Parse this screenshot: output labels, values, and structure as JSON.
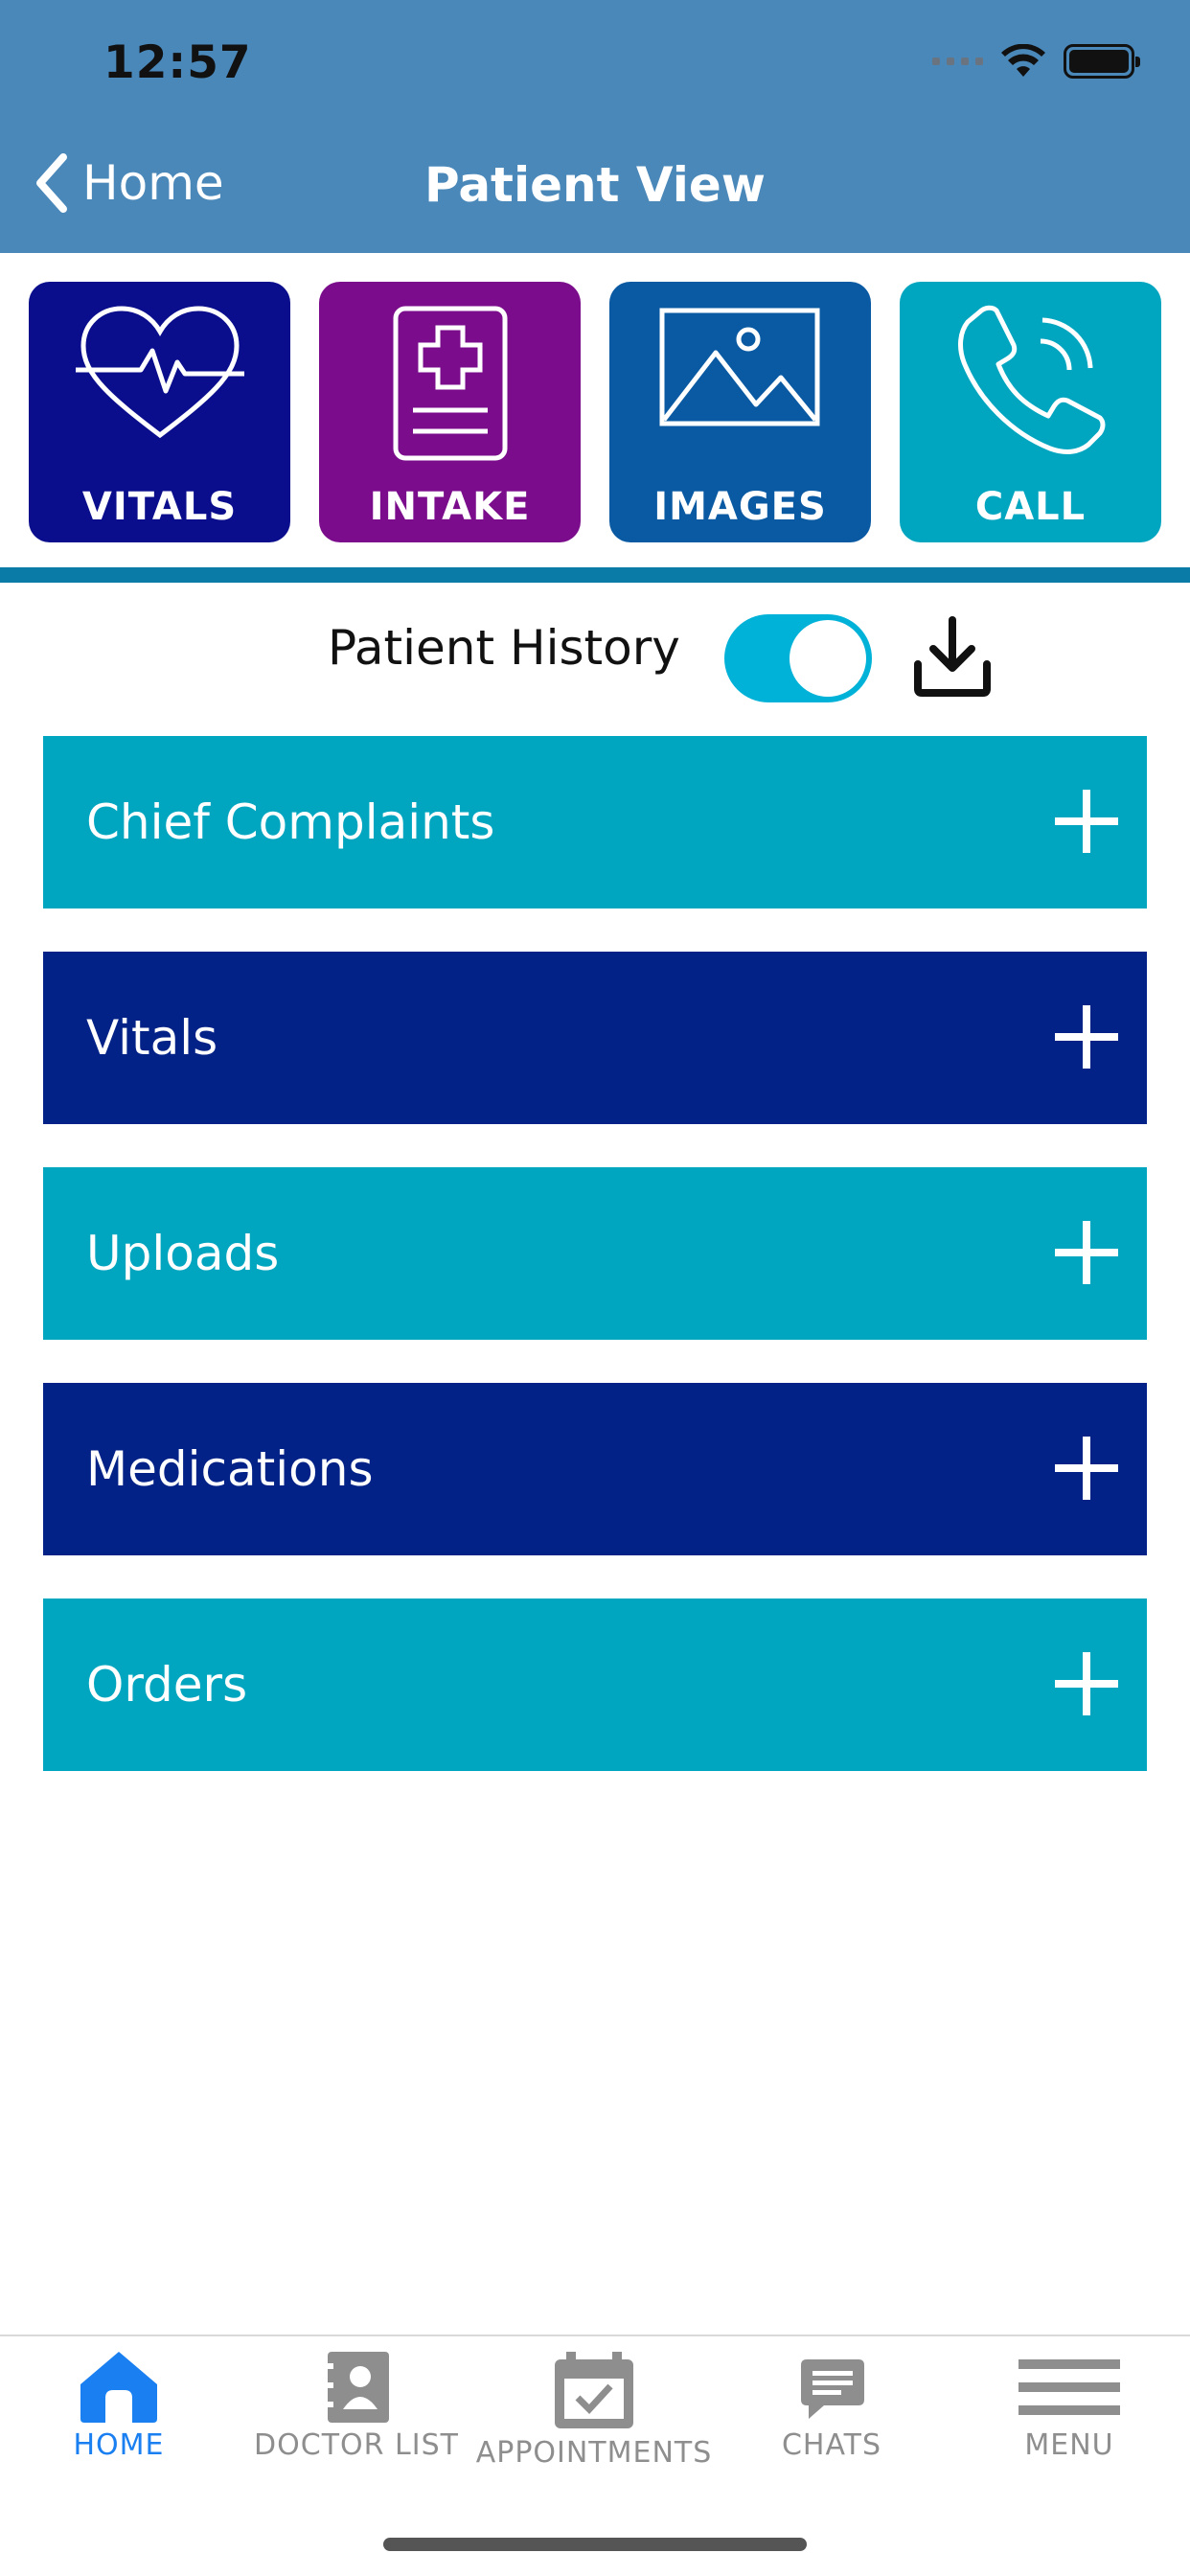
{
  "status_bar": {
    "time": "12:57"
  },
  "nav": {
    "back_label": "Home",
    "title": "Patient View"
  },
  "tiles": [
    {
      "label": "VITALS",
      "icon": "heart-pulse-icon",
      "color": "#0b0e8c"
    },
    {
      "label": "INTAKE",
      "icon": "medical-form-icon",
      "color": "#7b0d8c"
    },
    {
      "label": "IMAGES",
      "icon": "image-icon",
      "color": "#0a5aa3"
    },
    {
      "label": "CALL",
      "icon": "phone-icon",
      "color": "#00a6c0"
    }
  ],
  "history": {
    "label": "Patient History",
    "toggle_on": true
  },
  "sections": [
    {
      "label": "Chief Complaints",
      "color": "#00a6c0"
    },
    {
      "label": "Vitals",
      "color": "#022287"
    },
    {
      "label": "Uploads",
      "color": "#00a6c0"
    },
    {
      "label": "Medications",
      "color": "#022287"
    },
    {
      "label": "Orders",
      "color": "#00a6c0"
    }
  ],
  "tabbar": {
    "items": [
      {
        "label": "HOME",
        "icon": "home-icon",
        "active": true
      },
      {
        "label": "DOCTOR LIST",
        "icon": "contacts-book-icon",
        "active": false
      },
      {
        "label": "APPOINTMENTS",
        "icon": "calendar-check-icon",
        "active": false
      },
      {
        "label": "CHATS",
        "icon": "chat-bubble-icon",
        "active": false
      },
      {
        "label": "MENU",
        "icon": "hamburger-menu-icon",
        "active": false
      }
    ],
    "active_color": "#1a7ff0",
    "inactive_color": "#8e8e8e"
  }
}
